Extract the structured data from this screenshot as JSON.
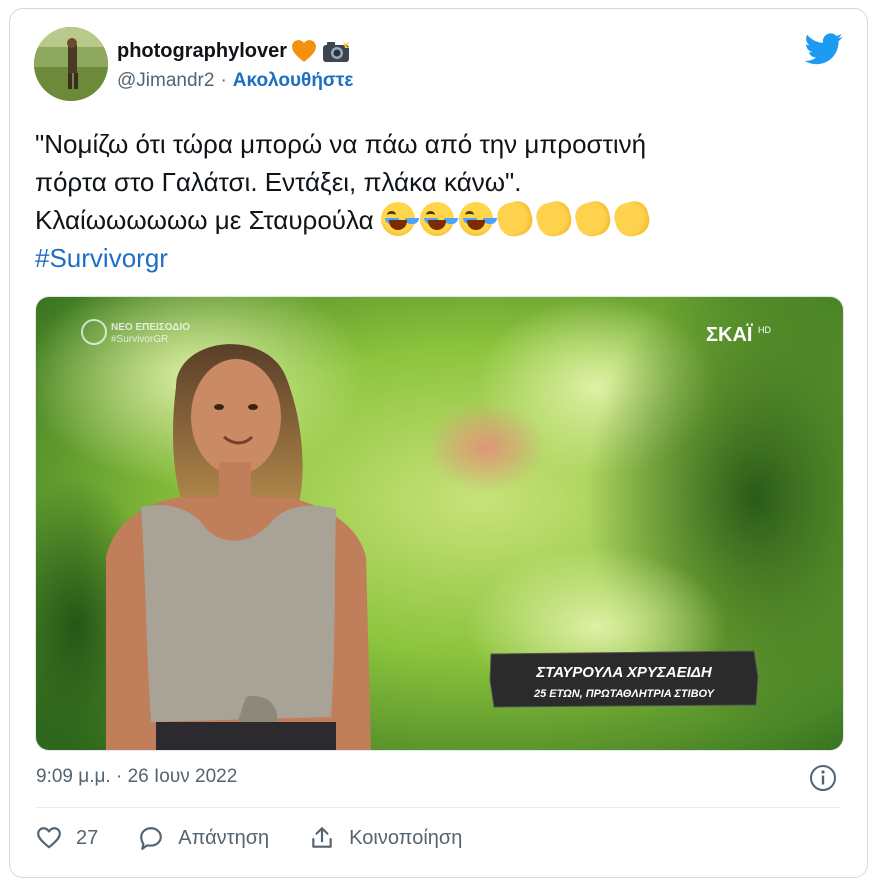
{
  "tweet": {
    "display_name": "photographylover",
    "name_emojis": [
      "orange-heart-icon",
      "camera-flash-icon"
    ],
    "handle": "@Jimandr2",
    "separator": "·",
    "follow_label": "Ακολουθήστε",
    "text_line_1": "\"Νομίζω ότι τώρα μπορώ να πάω από την μπροστινή",
    "text_line_2": "πόρτα στο Γαλάτσι. Εντάξει, πλάκα κάνω\".",
    "text_line_3": "Κλαίωωωωωω με Σταυρούλα",
    "hashtag": "#Survivorgr",
    "timestamp": "9:09 μ.μ. · 26 Ιουν 2022",
    "likes_count": "27",
    "reply_label": "Απάντηση",
    "share_label": "Κοινοποίηση"
  },
  "media": {
    "corner_overlay": "ΝΕΟ ΕΠΕΙΣΟΔΙΟ\n#SurvivorGR",
    "channel_logo": "ΣΚΑΪ",
    "channel_suffix": "HD",
    "lower_third_name": "ΣΤΑΥΡΟΥΛΑ ΧΡΥΣΑΕΙΔΗ",
    "lower_third_subtitle": "25 ΕΤΩΝ, ΠΡΩΤΑΘΛΗΤΡΙΑ ΣΤΙΒΟΥ"
  },
  "colors": {
    "link": "#1d6fc4",
    "twitter_blue": "#1d9bf0",
    "muted": "#536471"
  }
}
